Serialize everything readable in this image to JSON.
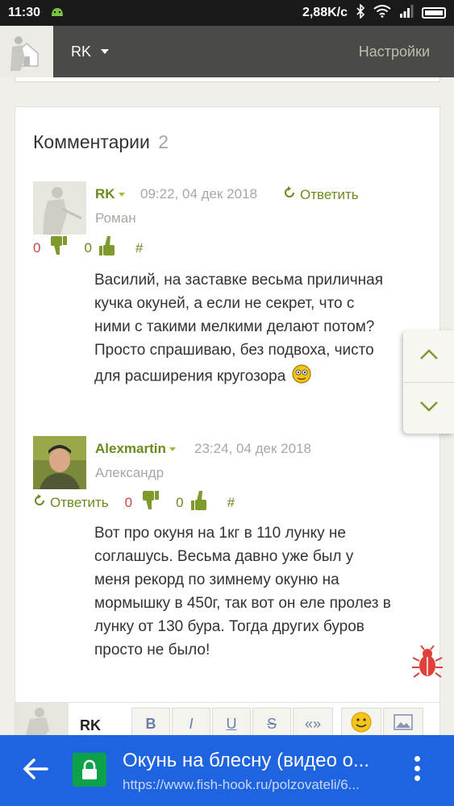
{
  "status_bar": {
    "time": "11:30",
    "network_speed": "2,88K/c"
  },
  "topnav": {
    "user": "RK",
    "settings": "Настройки"
  },
  "comments": {
    "title": "Комментарии",
    "count": "2",
    "items": [
      {
        "author": "RK",
        "date": "09:22, 04 дек 2018",
        "reply": "Ответить",
        "real_name": "Роман",
        "down_votes": "0",
        "up_votes": "0",
        "hash": "#",
        "text": "Василий, на заставке весьма приличная кучка окуней, а если не секрет, что с ними с такими мелкими делают потом? Просто спрашиваю, без подвоха, чисто для расширения кругозора"
      },
      {
        "author": "Alexmartin",
        "date": "23:24, 04 дек 2018",
        "reply": "Ответить",
        "real_name": "Александр",
        "down_votes": "0",
        "up_votes": "0",
        "hash": "#",
        "text": "Вот про окуня на 1кг в 110 лунку не соглашусь. Весьма давно уже был у меня рекорд по зимнему окуню на мормышку в 450г, так вот он еле пролез в лунку от 130 бура. Тогда других буров просто не было!"
      }
    ]
  },
  "editor": {
    "user": "RK",
    "tools": [
      "B",
      "I",
      "U",
      "S",
      "«»"
    ]
  },
  "urlbar": {
    "title": "Окунь на блесну (видео о...",
    "url": "https://www.fish-hook.ru/polzovateli/6..."
  },
  "colors": {
    "accent_green": "#6b8a1e",
    "url_bar": "#1e63e0",
    "nav": "#4a4a46"
  }
}
